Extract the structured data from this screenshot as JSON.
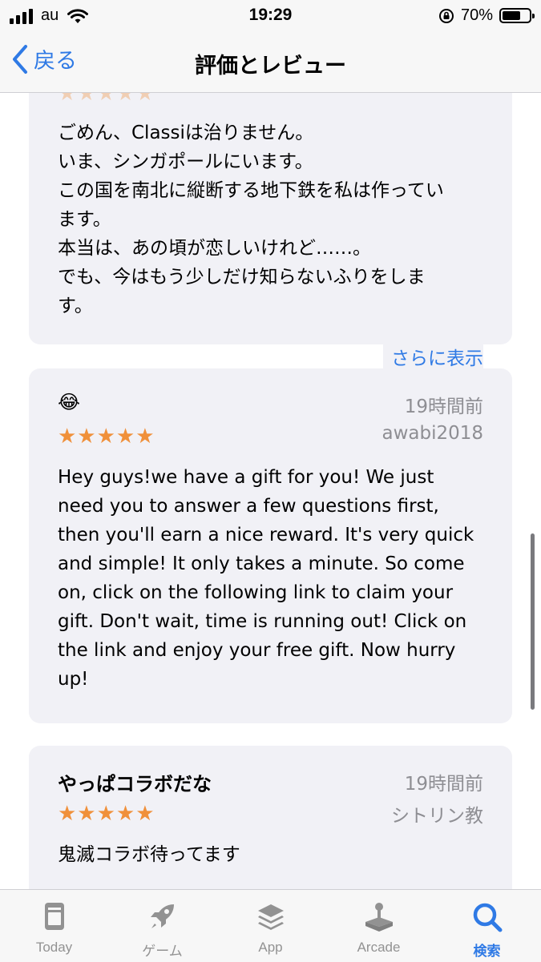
{
  "status_bar": {
    "carrier": "au",
    "time": "19:29",
    "battery_percent": "70%",
    "battery_level": 0.7
  },
  "nav": {
    "back_label": "戻る",
    "title": "評価とレビュー"
  },
  "reviews": [
    {
      "body": "ごめん、Classiは治りません。\nいま、シンガポールにいます。\nこの国を南北に縦断する地下鉄を私は作ってい\nます。\n本当は、あの頃が恋しいけれど……。\nでも、今はもう少しだけ知らないふりをしま\nす。",
      "more_label": "さらに表示",
      "stars": "★★★★★"
    },
    {
      "title": "😂",
      "date": "19時間前",
      "author": "awabi2018",
      "stars": "★★★★★",
      "body": "Hey guys!we have a gift for you! We just need you to answer a few questions first, then you'll earn a nice reward. It's very quick and simple! It only takes a minute. So come on, click on the following link to claim your gift. Don't wait, time is running out! Click on the link and enjoy your free gift. Now hurry up!"
    },
    {
      "title": "やっぱコラボだな",
      "date": "19時間前",
      "author": "シトリン教",
      "stars": "★★★★★",
      "body": "鬼滅コラボ待ってます"
    }
  ],
  "tab_bar": {
    "tabs": [
      {
        "label": "Today",
        "icon": "today-icon"
      },
      {
        "label": "ゲーム",
        "icon": "rocket-icon"
      },
      {
        "label": "App",
        "icon": "layers-icon"
      },
      {
        "label": "Arcade",
        "icon": "joystick-icon"
      },
      {
        "label": "検索",
        "icon": "search-icon"
      }
    ],
    "active_tab": "検索"
  },
  "colors": {
    "accent": "#2f7ae5",
    "star": "#f0903a",
    "card_bg": "#f1f1f6",
    "secondary_text": "#8e8e93"
  }
}
